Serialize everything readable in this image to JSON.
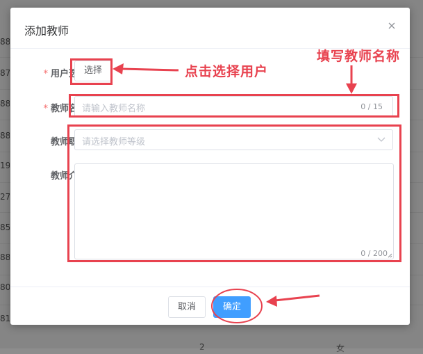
{
  "background": {
    "row_fragments": [
      "88",
      "87",
      "88",
      "88",
      "19",
      "27",
      "85",
      "88",
      "80",
      "81"
    ],
    "footer_fragments": [
      "2",
      "女"
    ]
  },
  "dialog": {
    "title": "添加教师",
    "fields": {
      "user": {
        "label": "用户选择",
        "button": "选择"
      },
      "name": {
        "label": "教师名称",
        "placeholder": "请输入教师名称",
        "counter": "0 / 15"
      },
      "rank": {
        "label": "教师职称",
        "placeholder": "请选择教师等级"
      },
      "intro": {
        "label": "教师介绍",
        "counter": "0 / 200"
      }
    },
    "footer": {
      "cancel": "取消",
      "confirm": "确定"
    }
  },
  "annotations": {
    "select_user_note": "点击选择用户",
    "fill_name_note": "填写教师名称",
    "color": "#e8424f"
  }
}
